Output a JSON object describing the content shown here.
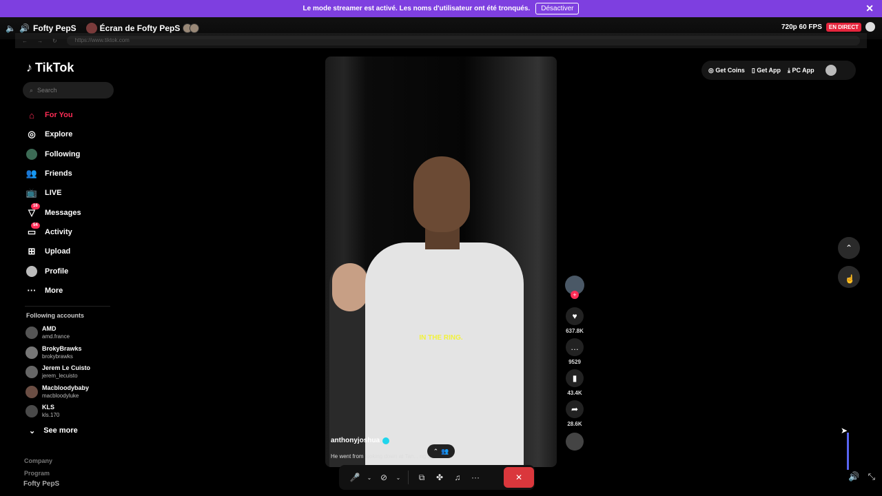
{
  "banner": {
    "message": "Le mode streamer est activé. Les noms d'utilisateur ont été tronqués.",
    "disable_label": "Désactiver",
    "close_glyph": "✕"
  },
  "stream": {
    "user": "Fofty PepS",
    "screen_title": "Écran de Fofty PepS",
    "quality": "720p 60 FPS",
    "live_badge": "EN DIRECT"
  },
  "browser": {
    "url": "https://www.tiktok.com"
  },
  "tiktok": {
    "logo_text": "TikTok",
    "search_placeholder": "Search",
    "nav": [
      {
        "label": "For You",
        "icon": "home-icon"
      },
      {
        "label": "Explore",
        "icon": "compass-icon"
      },
      {
        "label": "Following",
        "icon": "following-avatar-icon"
      },
      {
        "label": "Friends",
        "icon": "friends-icon"
      },
      {
        "label": "LIVE",
        "icon": "live-icon"
      },
      {
        "label": "Messages",
        "icon": "messages-icon",
        "badge": "16"
      },
      {
        "label": "Activity",
        "icon": "activity-icon",
        "badge": "54"
      },
      {
        "label": "Upload",
        "icon": "upload-icon"
      },
      {
        "label": "Profile",
        "icon": "profile-icon"
      },
      {
        "label": "More",
        "icon": "more-icon"
      }
    ],
    "following_title": "Following accounts",
    "accounts": [
      {
        "name": "AMD",
        "handle": "amd.france"
      },
      {
        "name": "BrokyBrawks",
        "handle": "brokybrawks"
      },
      {
        "name": "Jerem Le Cuisto",
        "handle": "jerem_lecuisto"
      },
      {
        "name": "Macbloodybaby",
        "handle": "macbloodyluke"
      },
      {
        "name": "KLS",
        "handle": "kls.170"
      }
    ],
    "see_more": "See more",
    "footer": [
      "Company",
      "Program"
    ],
    "top_pill": {
      "coins": "Get Coins",
      "app": "Get App",
      "pc_app": "PC App"
    },
    "video": {
      "caption_overlay": "IN THE RING.",
      "author": "anthonyjoshua",
      "description": "He went from looking down at Tan... ng up at one."
    },
    "actions": {
      "likes": "637.8K",
      "comments": "9529",
      "saves": "43.4K",
      "shares": "28.6K"
    }
  },
  "taskbar": {
    "label": "Fofty PepS"
  }
}
